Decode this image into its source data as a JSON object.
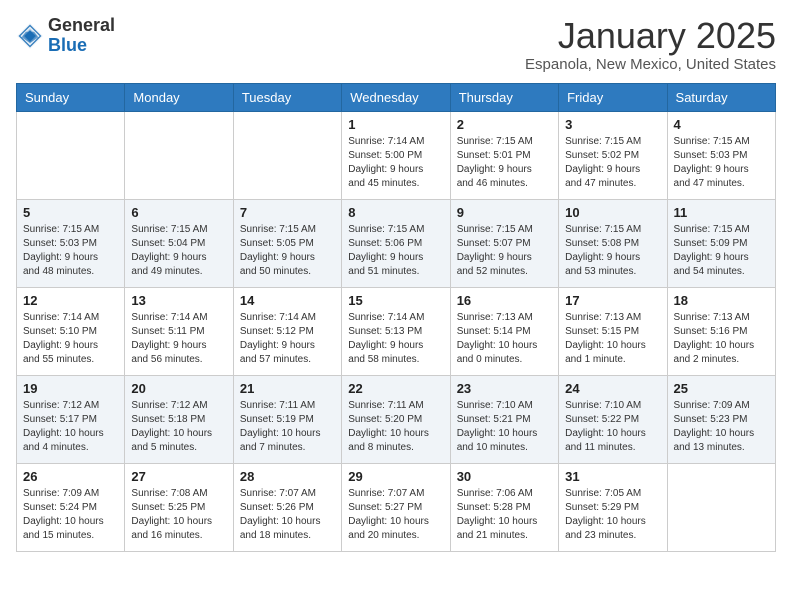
{
  "header": {
    "logo_general": "General",
    "logo_blue": "Blue",
    "month_title": "January 2025",
    "location": "Espanola, New Mexico, United States"
  },
  "days_of_week": [
    "Sunday",
    "Monday",
    "Tuesday",
    "Wednesday",
    "Thursday",
    "Friday",
    "Saturday"
  ],
  "weeks": [
    [
      {
        "day": "",
        "info": ""
      },
      {
        "day": "",
        "info": ""
      },
      {
        "day": "",
        "info": ""
      },
      {
        "day": "1",
        "info": "Sunrise: 7:14 AM\nSunset: 5:00 PM\nDaylight: 9 hours\nand 45 minutes."
      },
      {
        "day": "2",
        "info": "Sunrise: 7:15 AM\nSunset: 5:01 PM\nDaylight: 9 hours\nand 46 minutes."
      },
      {
        "day": "3",
        "info": "Sunrise: 7:15 AM\nSunset: 5:02 PM\nDaylight: 9 hours\nand 47 minutes."
      },
      {
        "day": "4",
        "info": "Sunrise: 7:15 AM\nSunset: 5:03 PM\nDaylight: 9 hours\nand 47 minutes."
      }
    ],
    [
      {
        "day": "5",
        "info": "Sunrise: 7:15 AM\nSunset: 5:03 PM\nDaylight: 9 hours\nand 48 minutes."
      },
      {
        "day": "6",
        "info": "Sunrise: 7:15 AM\nSunset: 5:04 PM\nDaylight: 9 hours\nand 49 minutes."
      },
      {
        "day": "7",
        "info": "Sunrise: 7:15 AM\nSunset: 5:05 PM\nDaylight: 9 hours\nand 50 minutes."
      },
      {
        "day": "8",
        "info": "Sunrise: 7:15 AM\nSunset: 5:06 PM\nDaylight: 9 hours\nand 51 minutes."
      },
      {
        "day": "9",
        "info": "Sunrise: 7:15 AM\nSunset: 5:07 PM\nDaylight: 9 hours\nand 52 minutes."
      },
      {
        "day": "10",
        "info": "Sunrise: 7:15 AM\nSunset: 5:08 PM\nDaylight: 9 hours\nand 53 minutes."
      },
      {
        "day": "11",
        "info": "Sunrise: 7:15 AM\nSunset: 5:09 PM\nDaylight: 9 hours\nand 54 minutes."
      }
    ],
    [
      {
        "day": "12",
        "info": "Sunrise: 7:14 AM\nSunset: 5:10 PM\nDaylight: 9 hours\nand 55 minutes."
      },
      {
        "day": "13",
        "info": "Sunrise: 7:14 AM\nSunset: 5:11 PM\nDaylight: 9 hours\nand 56 minutes."
      },
      {
        "day": "14",
        "info": "Sunrise: 7:14 AM\nSunset: 5:12 PM\nDaylight: 9 hours\nand 57 minutes."
      },
      {
        "day": "15",
        "info": "Sunrise: 7:14 AM\nSunset: 5:13 PM\nDaylight: 9 hours\nand 58 minutes."
      },
      {
        "day": "16",
        "info": "Sunrise: 7:13 AM\nSunset: 5:14 PM\nDaylight: 10 hours\nand 0 minutes."
      },
      {
        "day": "17",
        "info": "Sunrise: 7:13 AM\nSunset: 5:15 PM\nDaylight: 10 hours\nand 1 minute."
      },
      {
        "day": "18",
        "info": "Sunrise: 7:13 AM\nSunset: 5:16 PM\nDaylight: 10 hours\nand 2 minutes."
      }
    ],
    [
      {
        "day": "19",
        "info": "Sunrise: 7:12 AM\nSunset: 5:17 PM\nDaylight: 10 hours\nand 4 minutes."
      },
      {
        "day": "20",
        "info": "Sunrise: 7:12 AM\nSunset: 5:18 PM\nDaylight: 10 hours\nand 5 minutes."
      },
      {
        "day": "21",
        "info": "Sunrise: 7:11 AM\nSunset: 5:19 PM\nDaylight: 10 hours\nand 7 minutes."
      },
      {
        "day": "22",
        "info": "Sunrise: 7:11 AM\nSunset: 5:20 PM\nDaylight: 10 hours\nand 8 minutes."
      },
      {
        "day": "23",
        "info": "Sunrise: 7:10 AM\nSunset: 5:21 PM\nDaylight: 10 hours\nand 10 minutes."
      },
      {
        "day": "24",
        "info": "Sunrise: 7:10 AM\nSunset: 5:22 PM\nDaylight: 10 hours\nand 11 minutes."
      },
      {
        "day": "25",
        "info": "Sunrise: 7:09 AM\nSunset: 5:23 PM\nDaylight: 10 hours\nand 13 minutes."
      }
    ],
    [
      {
        "day": "26",
        "info": "Sunrise: 7:09 AM\nSunset: 5:24 PM\nDaylight: 10 hours\nand 15 minutes."
      },
      {
        "day": "27",
        "info": "Sunrise: 7:08 AM\nSunset: 5:25 PM\nDaylight: 10 hours\nand 16 minutes."
      },
      {
        "day": "28",
        "info": "Sunrise: 7:07 AM\nSunset: 5:26 PM\nDaylight: 10 hours\nand 18 minutes."
      },
      {
        "day": "29",
        "info": "Sunrise: 7:07 AM\nSunset: 5:27 PM\nDaylight: 10 hours\nand 20 minutes."
      },
      {
        "day": "30",
        "info": "Sunrise: 7:06 AM\nSunset: 5:28 PM\nDaylight: 10 hours\nand 21 minutes."
      },
      {
        "day": "31",
        "info": "Sunrise: 7:05 AM\nSunset: 5:29 PM\nDaylight: 10 hours\nand 23 minutes."
      },
      {
        "day": "",
        "info": ""
      }
    ]
  ]
}
